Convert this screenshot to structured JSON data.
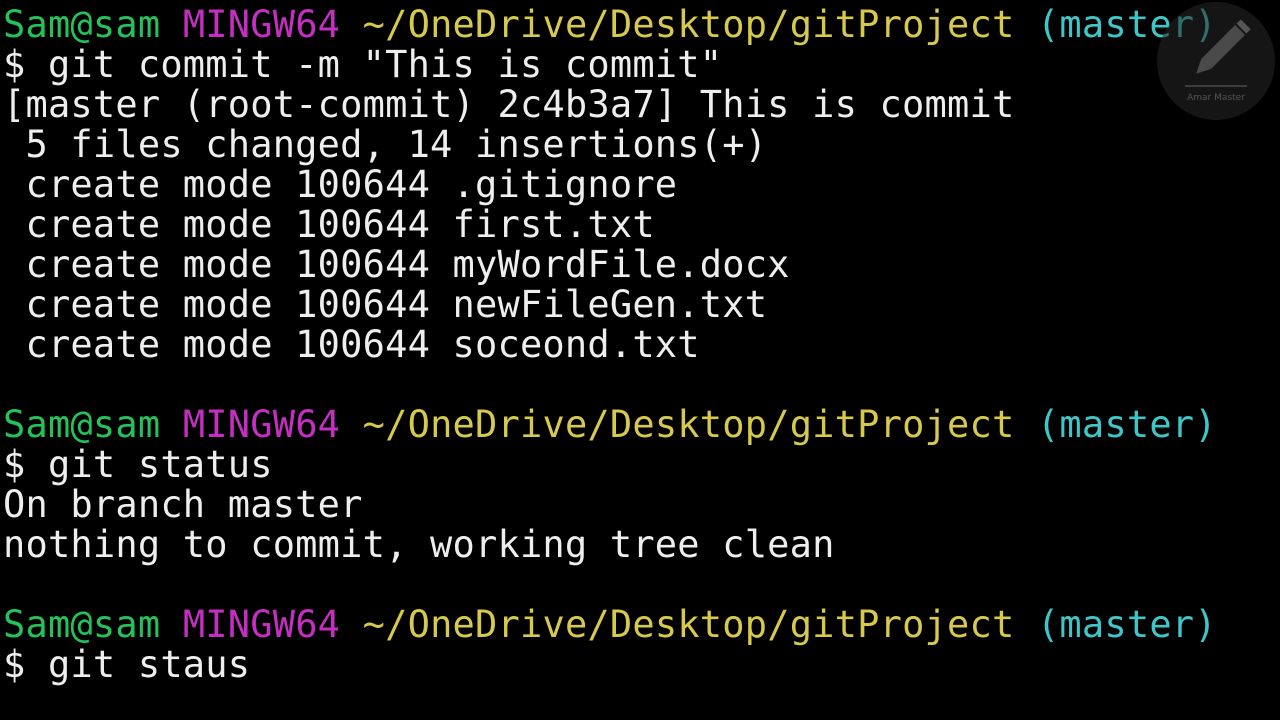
{
  "prompt_style": {
    "user_color": "#25c25a",
    "host_color": "#c42fc2",
    "path_color": "#d6c94c",
    "branch_color": "#3fc6c8",
    "text_color": "#eeeeee",
    "background": "#000000"
  },
  "terminal": {
    "prompts": [
      {
        "user": "Sam@sam",
        "host": "MINGW64",
        "path": "~/OneDrive/Desktop/gitProject",
        "branch": "(master)"
      },
      {
        "user": "Sam@sam",
        "host": "MINGW64",
        "path": "~/OneDrive/Desktop/gitProject",
        "branch": "(master)"
      },
      {
        "user": "Sam@sam",
        "host": "MINGW64",
        "path": "~/OneDrive/Desktop/gitProject",
        "branch": "(master)"
      }
    ],
    "commands": [
      "$ git commit -m \"This is commit\"",
      "$ git status",
      "$ git staus"
    ],
    "commit_output": [
      "[master (root-commit) 2c4b3a7] This is commit",
      " 5 files changed, 14 insertions(+)",
      " create mode 100644 .gitignore",
      " create mode 100644 first.txt",
      " create mode 100644 myWordFile.docx",
      " create mode 100644 newFileGen.txt",
      " create mode 100644 soceond.txt"
    ],
    "status_output": [
      "On branch master",
      "nothing to commit, working tree clean"
    ]
  },
  "watermark": {
    "icon": "pencil-icon",
    "text": "Amar Master"
  }
}
